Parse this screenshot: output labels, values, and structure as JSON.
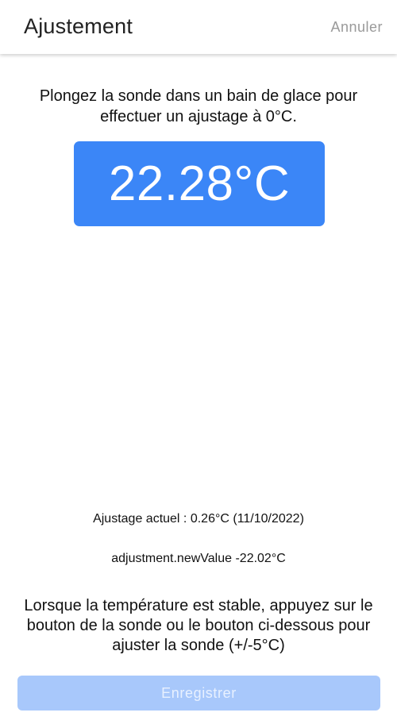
{
  "header": {
    "title": "Ajustement",
    "cancel_label": "Annuler"
  },
  "main": {
    "instruction": "Plongez la sonde dans un bain de glace pour effectuer un ajustage à 0°C.",
    "temperature": "22.28°C",
    "temperature_box_color": "#3b86f7",
    "current_adjustment": "Ajustage actuel : 0.26°C (11/10/2022)",
    "new_value": "adjustment.newValue -22.02°C",
    "stable_instruction": "Lorsque la température est stable, appuyez sur le bouton de la sonde ou le bouton ci-dessous pour ajuster la sonde (+/-5°C)"
  },
  "footer": {
    "save_label": "Enregistrer",
    "save_enabled": false,
    "save_color": "#a8c8fb"
  }
}
